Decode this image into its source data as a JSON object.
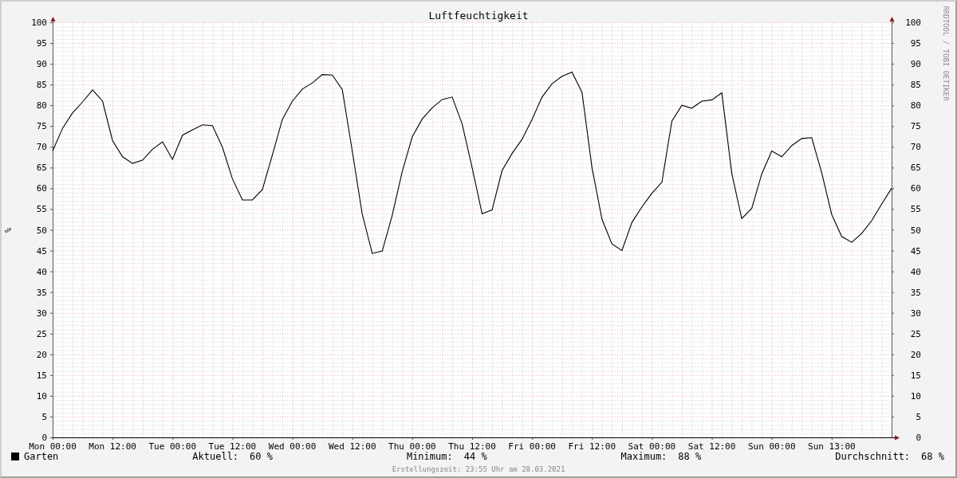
{
  "chart": {
    "chart_data": {
      "type": "line",
      "title": "Luftfeuchtigkeit",
      "ylabel": "%",
      "ylim": [
        0,
        100
      ],
      "grid": true,
      "categories": [
        "Mon 00:00",
        null,
        null,
        null,
        null,
        null,
        "Mon 12:00",
        null,
        null,
        null,
        null,
        null,
        "Tue 00:00",
        null,
        null,
        null,
        null,
        null,
        "Tue 12:00",
        null,
        null,
        null,
        null,
        null,
        "Wed 00:00",
        null,
        null,
        null,
        null,
        null,
        "Wed 12:00",
        null,
        null,
        null,
        null,
        null,
        "Thu 00:00",
        null,
        null,
        null,
        null,
        null,
        "Thu 12:00",
        null,
        null,
        null,
        null,
        null,
        "Fri 00:00",
        null,
        null,
        null,
        null,
        null,
        "Fri 12:00",
        null,
        null,
        null,
        null,
        null,
        "Sat 00:00",
        null,
        null,
        null,
        null,
        null,
        "Sat 12:00",
        null,
        null,
        null,
        null,
        null,
        "Sun 00:00",
        null,
        null,
        null,
        null,
        null,
        "Sun 13:00",
        null,
        null,
        null,
        null,
        null,
        null
      ],
      "series": [
        {
          "name": "Garten",
          "color": "#000000",
          "values": [
            69,
            74.5,
            78.2,
            80.8,
            83.7,
            81,
            71.5,
            67.6,
            66,
            66.8,
            69.4,
            71.2,
            67,
            72.8,
            74.1,
            75.3,
            75.1,
            69.9,
            62.3,
            57.2,
            57.2,
            59.7,
            68,
            76.6,
            81,
            83.9,
            85.4,
            87.4,
            87.3,
            83.8,
            69,
            53.8,
            44.3,
            44.9,
            53.5,
            64,
            72.4,
            76.7,
            79.4,
            81.4,
            82,
            75.5,
            65,
            53.9,
            54.8,
            64.3,
            68.4,
            71.8,
            76.6,
            82,
            85.2,
            87,
            88,
            83.1,
            65,
            52.6,
            46.6,
            45,
            51.8,
            55.5,
            58.8,
            61.5,
            76.2,
            80,
            79.3,
            81,
            81.3,
            83,
            63.6,
            52.7,
            55.2,
            63.5,
            69,
            67.6,
            70.3,
            72,
            72.2,
            63.8,
            53.7,
            48.4,
            47,
            49.1,
            52.2,
            56.2,
            60
          ]
        }
      ],
      "yticks": [
        0,
        5,
        10,
        15,
        20,
        25,
        30,
        35,
        40,
        45,
        50,
        55,
        60,
        65,
        70,
        75,
        80,
        85,
        90,
        95,
        100
      ]
    },
    "right_axis_labels": [
      "100",
      "95",
      "90",
      "85",
      "80",
      "75",
      "70",
      "65",
      "60",
      "55",
      "50",
      "45",
      "40",
      "35",
      "30",
      "25",
      "20",
      "15",
      "10",
      "5",
      "0"
    ],
    "credit": "RRDTOOL / TOBI OETIKER"
  },
  "legend": {
    "stats": [
      {
        "label": "Aktuell:",
        "value": "60 %"
      },
      {
        "label": "Minimum:",
        "value": "44 %"
      },
      {
        "label": "Maximum:",
        "value": "88 %"
      },
      {
        "label": "Durchschnitt:",
        "value": "68 %"
      }
    ]
  },
  "footer": "Erstellungszeit: 23:55 Uhr am 28.03.2021"
}
